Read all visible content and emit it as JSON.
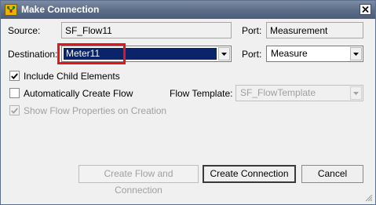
{
  "window": {
    "title": "Make Connection"
  },
  "fields": {
    "source_label": "Source:",
    "source_value": "SF_Flow11",
    "source_port_label": "Port:",
    "source_port_value": "Measurement",
    "destination_label": "Destination:",
    "destination_value": "Meter11",
    "destination_port_label": "Port:",
    "destination_port_value": "Measure"
  },
  "options": {
    "include_child_label": "Include Child Elements",
    "include_child_checked": true,
    "auto_create_flow_label": "Automatically Create Flow",
    "auto_create_flow_checked": false,
    "flow_template_label": "Flow Template:",
    "flow_template_value": "SF_FlowTemplate",
    "show_flow_props_label": "Show Flow Properties on Creation",
    "show_flow_props_checked": true
  },
  "buttons": {
    "create_flow_and_connection": "Create Flow and Connection",
    "create_connection": "Create Connection",
    "cancel": "Cancel"
  },
  "icons": {
    "app": "make-connection-app-icon",
    "close": "close-icon",
    "dropdown": "chevron-down-icon",
    "check": "checkmark-icon",
    "resize": "resize-grip-icon"
  },
  "colors": {
    "titlebar": "#5d6e89",
    "selection": "#0a246a",
    "highlight": "#e8141c"
  }
}
